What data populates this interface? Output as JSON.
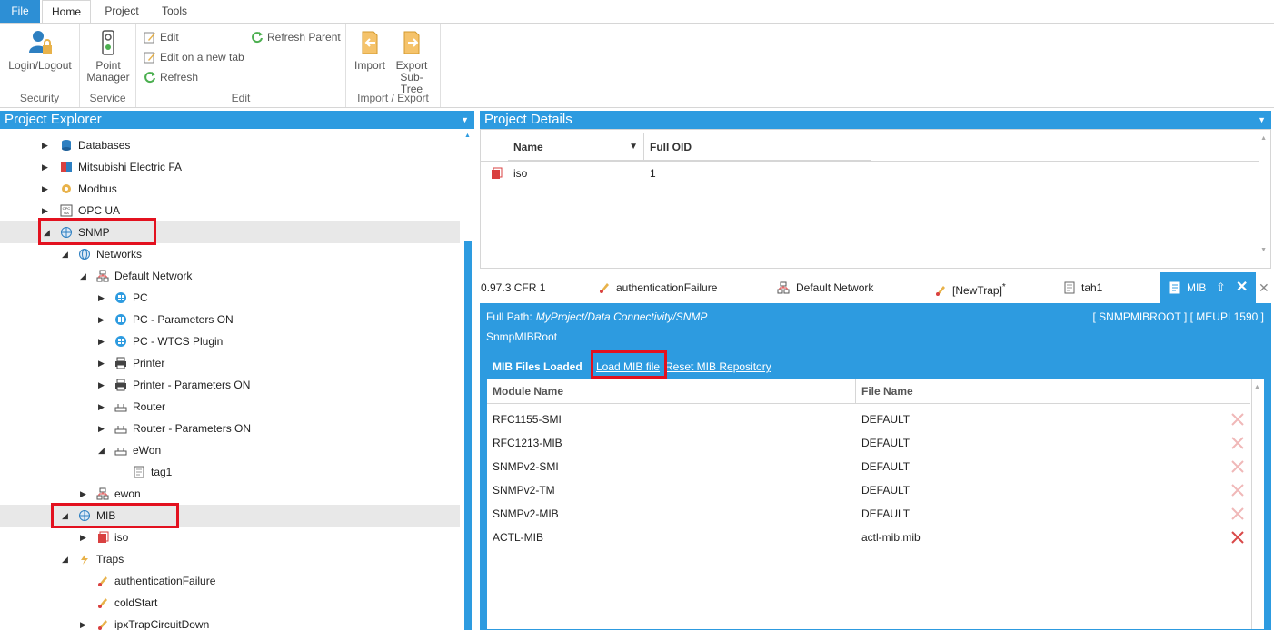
{
  "ribbon": {
    "tabs": [
      "File",
      "Home",
      "Project",
      "Tools"
    ],
    "security": {
      "login_label": "Login/Logout",
      "group": "Security"
    },
    "service": {
      "point_manager_label_1": "Point",
      "point_manager_label_2": "Manager",
      "group": "Service"
    },
    "edit": {
      "edit": "Edit",
      "edit_new_tab": "Edit on a new tab",
      "refresh": "Refresh",
      "refresh_parent": "Refresh Parent",
      "group": "Edit"
    },
    "import_export": {
      "import": "Import",
      "export_1": "Export",
      "export_2": "Sub-Tree",
      "group": "Import / Export"
    }
  },
  "explorer": {
    "title": "Project Explorer",
    "items": [
      {
        "label": "Databases",
        "icon": "database-icon"
      },
      {
        "label": "Mitsubishi Electric FA",
        "icon": "mitsubishi-icon"
      },
      {
        "label": "Modbus",
        "icon": "modbus-icon"
      },
      {
        "label": "OPC UA",
        "icon": "opc-ua-icon"
      },
      {
        "label": "SNMP",
        "icon": "snmp-icon"
      },
      {
        "label": "Networks",
        "icon": "globe-icon"
      },
      {
        "label": "Default Network",
        "icon": "network-icon"
      },
      {
        "label": "PC",
        "icon": "windows-icon"
      },
      {
        "label": "PC - Parameters ON",
        "icon": "windows-icon"
      },
      {
        "label": "PC - WTCS Plugin",
        "icon": "windows-icon"
      },
      {
        "label": "Printer",
        "icon": "printer-icon"
      },
      {
        "label": "Printer - Parameters ON",
        "icon": "printer-icon"
      },
      {
        "label": "Router",
        "icon": "router-icon"
      },
      {
        "label": "Router - Parameters ON",
        "icon": "router-icon"
      },
      {
        "label": "eWon",
        "icon": "router-icon"
      },
      {
        "label": "tag1",
        "icon": "tag-icon"
      },
      {
        "label": "ewon",
        "icon": "network-icon"
      },
      {
        "label": "MIB",
        "icon": "mib-icon"
      },
      {
        "label": "iso",
        "icon": "book-icon"
      },
      {
        "label": "Traps",
        "icon": "lightning-icon"
      },
      {
        "label": "authenticationFailure",
        "icon": "trap-icon"
      },
      {
        "label": "coldStart",
        "icon": "trap-icon"
      },
      {
        "label": "ipxTrapCircuitDown",
        "icon": "trap-icon"
      }
    ]
  },
  "details": {
    "title": "Project Details",
    "columns": [
      "Name",
      "Full OID"
    ],
    "rows": [
      {
        "name": "iso",
        "oid": "1"
      }
    ]
  },
  "doc_tabs": {
    "version": "0.97.3 CFR 1",
    "tabs": [
      "authenticationFailure",
      "Default Network",
      "[NewTrap]",
      "tah1",
      "MIB"
    ],
    "unsaved_marker": "*"
  },
  "mib_pane": {
    "full_path_label": "Full Path:",
    "full_path": "MyProject/Data Connectivity/SNMP",
    "root_id": "[ SNMPMIBROOT ] [ MEUPL1590 ]",
    "root_name": "SnmpMIBRoot",
    "files_loaded": "MIB Files Loaded",
    "load_link": "Load MIB file",
    "reset_link": "Reset MIB Repository",
    "columns": [
      "Module Name",
      "File Name"
    ],
    "rows": [
      {
        "module": "RFC1155-SMI",
        "file": "DEFAULT"
      },
      {
        "module": "RFC1213-MIB",
        "file": "DEFAULT"
      },
      {
        "module": "SNMPv2-SMI",
        "file": "DEFAULT"
      },
      {
        "module": "SNMPv2-TM",
        "file": "DEFAULT"
      },
      {
        "module": "SNMPv2-MIB",
        "file": "DEFAULT"
      },
      {
        "module": "ACTL-MIB",
        "file": "actl-mib.mib"
      }
    ]
  },
  "colors": {
    "accent": "#2d9be0",
    "highlight": "#e3111f"
  }
}
